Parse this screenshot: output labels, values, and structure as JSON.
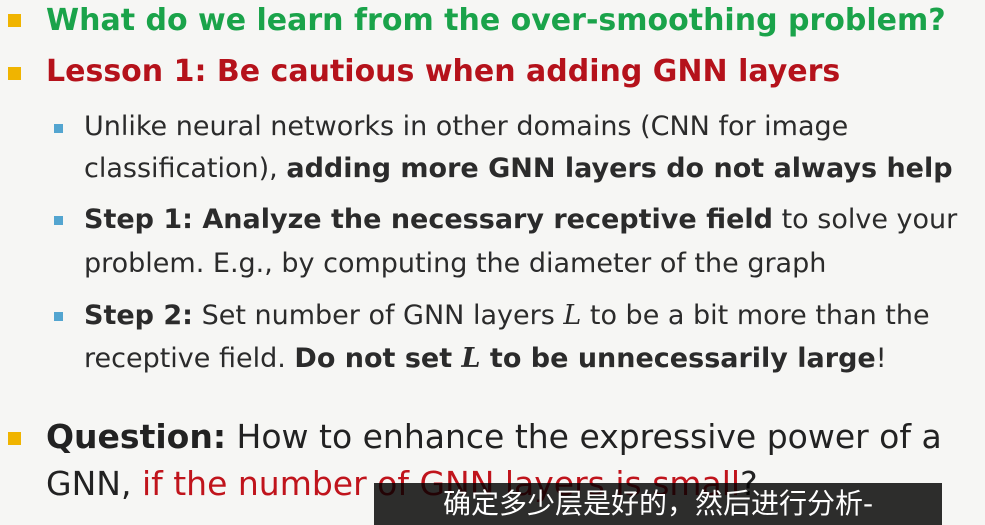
{
  "heading1": "What do we learn from the over-smoothing problem?",
  "heading2": "Lesson 1: Be cautious when adding GNN layers",
  "sub1": {
    "l1": "Unlike neural networks in other domains (CNN for image",
    "l2_pre": "classification), ",
    "l2_bold": "adding more GNN layers do not always help"
  },
  "sub2": {
    "l1_bold": "Step 1: Analyze the necessary receptive field",
    "l1_rest": " to solve your",
    "l2": "problem. E.g., by computing the diameter of the graph"
  },
  "sub3": {
    "l1_bold": "Step 2:",
    "l1_a": " Set number of GNN layers ",
    "var": "L",
    "l1_b": " to be a bit more than the",
    "l2_pre": "receptive field. ",
    "l2_bold_a": "Do not set ",
    "l2_bold_b": " to be unnecessarily large",
    "l2_end": "!"
  },
  "question": {
    "bold": "Question:",
    "l1_rest": " How to enhance the expressive power of a",
    "l2_pre": "GNN, ",
    "l2_red": "if the number of GNN layers is small",
    "l2_end": "?"
  },
  "subtitle": "确定多少层是好的，然后进行分析-",
  "colors": {
    "green": "#1aa34a",
    "red": "#b5121b",
    "bullet_yellow": "#f0b400",
    "bullet_blue": "#53a5d0"
  }
}
